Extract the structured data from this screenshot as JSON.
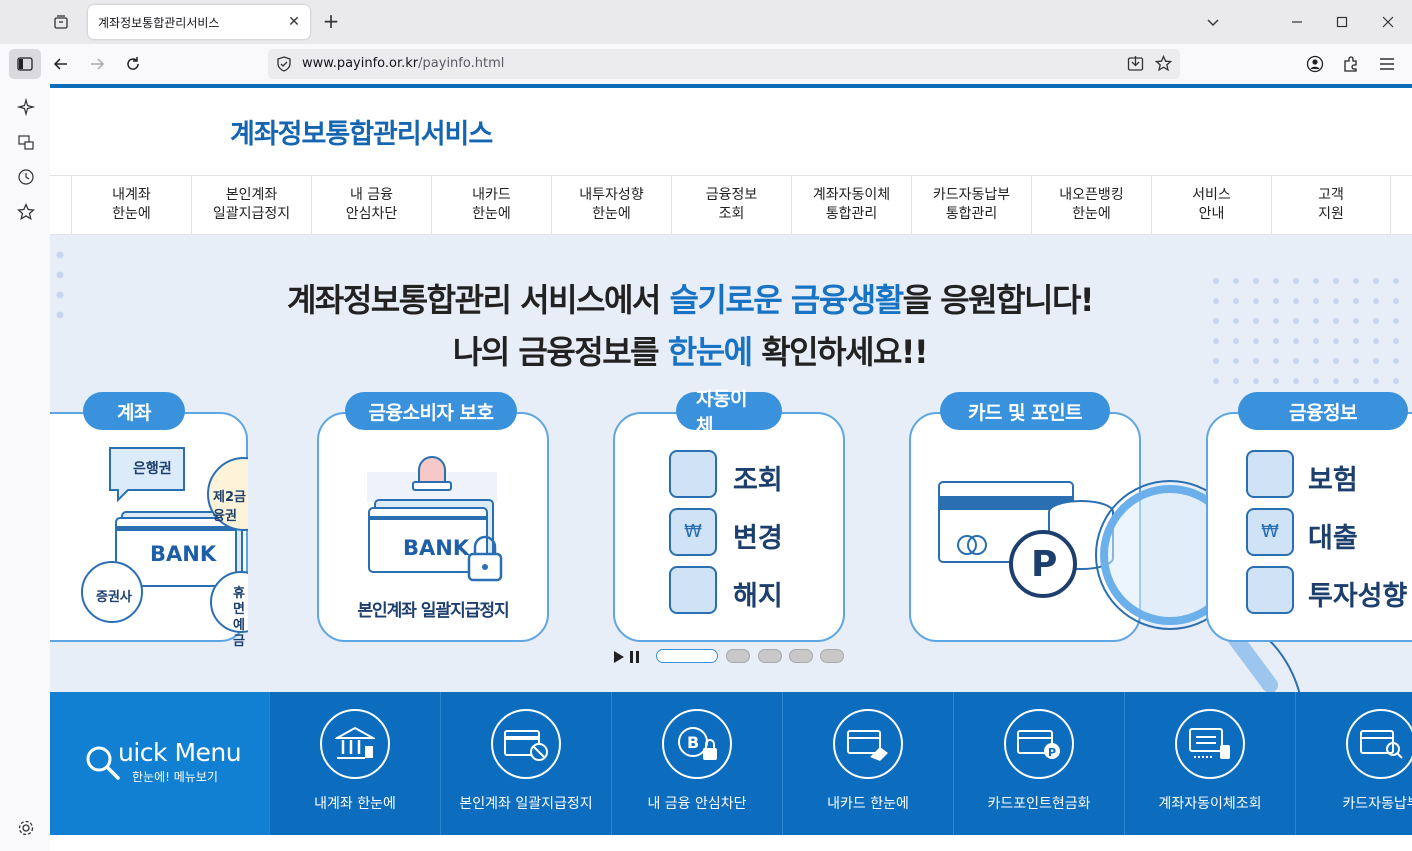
{
  "browser": {
    "tab_title": "계좌정보통합관리서비스",
    "url_host": "www.payinfo.or.kr",
    "url_path": "/payinfo.html"
  },
  "site": {
    "title": "계좌정보통합관리서비스"
  },
  "gnb": [
    {
      "label": "내계좌\n한눈에"
    },
    {
      "label": "본인계좌\n일괄지급정지"
    },
    {
      "label": "내 금융\n안심차단"
    },
    {
      "label": "내카드\n한눈에"
    },
    {
      "label": "내투자성향\n한눈에"
    },
    {
      "label": "금융정보\n조회"
    },
    {
      "label": "계좌자동이체\n통합관리"
    },
    {
      "label": "카드자동납부\n통합관리"
    },
    {
      "label": "내오픈뱅킹\n한눈에"
    },
    {
      "label": "서비스\n안내"
    },
    {
      "label": "고객\n지원"
    }
  ],
  "hero": {
    "line1_pre": "계좌정보통합관리 서비스에서 ",
    "line1_em": "슬기로운 금융생활",
    "line1_post": "을 응원합니다!",
    "line2_pre": "나의 금융정보를 ",
    "line2_em": "한눈에",
    "line2_post": " 확인하세요!!"
  },
  "cards": [
    {
      "label": "계좌",
      "bubble1": "은행권",
      "bubble2": "제2금융권",
      "bank": "BANK",
      "bubble3": "증권사",
      "bubble4_1": "휴면",
      "bubble4_2": "예금"
    },
    {
      "label": "금융소비자 보호",
      "bank": "BANK",
      "caption": "본인계좌 일괄지급정지"
    },
    {
      "label": "자동이체",
      "items": [
        "조회",
        "변경",
        "해지"
      ]
    },
    {
      "label": "카드 및 포인트",
      "badge": "P"
    },
    {
      "label": "금융정보",
      "items": [
        "보험",
        "대출",
        "투자성향"
      ]
    }
  ],
  "quick_menu": {
    "title": "uick Menu",
    "subtitle": "한눈에! 메뉴보기",
    "items": [
      {
        "label": "내계좌 한눈에",
        "icon": "bank-icon"
      },
      {
        "label": "본인계좌 일괄지급정지",
        "icon": "card-block-icon"
      },
      {
        "label": "내 금융 안심차단",
        "icon": "lock-coin-icon"
      },
      {
        "label": "내카드 한눈에",
        "icon": "card-hand-icon"
      },
      {
        "label": "카드포인트현금화",
        "icon": "card-point-icon"
      },
      {
        "label": "계좌자동이체조회",
        "icon": "transfer-icon"
      },
      {
        "label": "카드자동납부",
        "icon": "card-search-icon"
      }
    ]
  },
  "colors": {
    "brand_blue": "#1565b1",
    "accent_blue": "#3a92dc",
    "quick_bg": "#0c6dbf"
  }
}
